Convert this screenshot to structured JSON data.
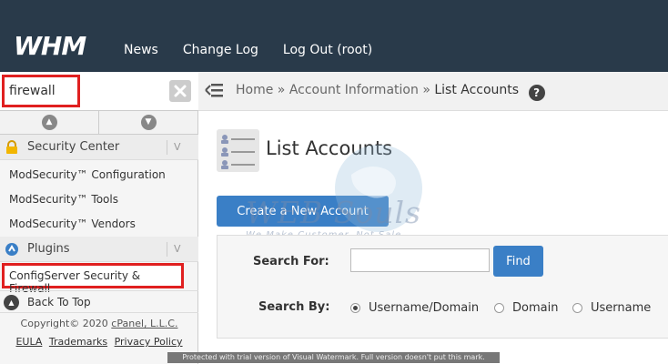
{
  "header": {
    "logo": "WHM",
    "nav": [
      "News",
      "Change Log",
      "Log Out (root)"
    ]
  },
  "sidebar": {
    "search_value": "firewall",
    "clear_icon": "x-icon",
    "categories": [
      {
        "label": "Security Center",
        "items": [
          "ModSecurity™ Configuration",
          "ModSecurity™ Tools",
          "ModSecurity™ Vendors"
        ]
      },
      {
        "label": "Plugins",
        "items": [
          "ConfigServer Security & Firewall"
        ]
      }
    ],
    "back_to_top": "Back To Top",
    "copyright_prefix": "Copyright© 2020",
    "copyright_link": "cPanel, L.L.C.",
    "footer_links": [
      "EULA",
      "Trademarks",
      "Privacy Policy"
    ]
  },
  "breadcrumb": {
    "items": [
      "Home",
      "Account Information",
      "List Accounts"
    ],
    "separator": "»",
    "help": "?"
  },
  "main": {
    "title": "List Accounts",
    "create_button": "Create a New Account",
    "search_for_label": "Search For:",
    "search_for_value": "",
    "find_button": "Find",
    "search_by_label": "Search By:",
    "search_by_options": [
      "Username/Domain",
      "Domain",
      "Username"
    ],
    "search_by_selected": "Username/Domain"
  },
  "watermark": {
    "brand": "WEB Souls",
    "tagline": "We Make Customer, Not Sale"
  },
  "trial_banner": "Protected with trial version of Visual Watermark. Full version doesn't put this mark.",
  "colors": {
    "topbar": "#293a4a",
    "primary_button": "#3a7fc6",
    "highlight": "#e02020"
  }
}
